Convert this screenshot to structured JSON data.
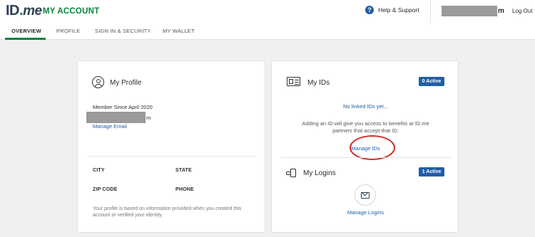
{
  "header": {
    "logo_main": "ID",
    "logo_dot": ".",
    "logo_me": "me",
    "title": "MY ACCOUNT",
    "help_label": "Help & Support",
    "help_icon": "?",
    "user_suffix": "m",
    "logout_label": "Log Out"
  },
  "nav": {
    "tabs": [
      "OVERVIEW",
      "PROFILE",
      "SIGN IN & SECURITY",
      "MY WALLET"
    ],
    "active_index": 0
  },
  "profile": {
    "title": "My Profile",
    "member_since": "Member Since April 2020",
    "email_suffix": "m",
    "manage_email": "Manage Email",
    "fields": {
      "city": "CITY",
      "state": "STATE",
      "zip": "ZIP CODE",
      "phone": "PHONE"
    },
    "note": "Your profile is based on information provided when you created this account or verified your identity."
  },
  "ids": {
    "title": "My IDs",
    "badge": "0 Active",
    "no_ids": "No linked IDs yet...",
    "info": "Adding an ID will give you access to benefits at ID.me partners that accept that ID.",
    "manage_ids": "Manage IDs"
  },
  "logins": {
    "title": "My Logins",
    "badge": "1 Active",
    "manage_logins": "Manage Logins"
  },
  "colors": {
    "brand_green": "#08833d",
    "link_blue": "#1f5ea8",
    "highlight_red": "#d42a2a"
  }
}
